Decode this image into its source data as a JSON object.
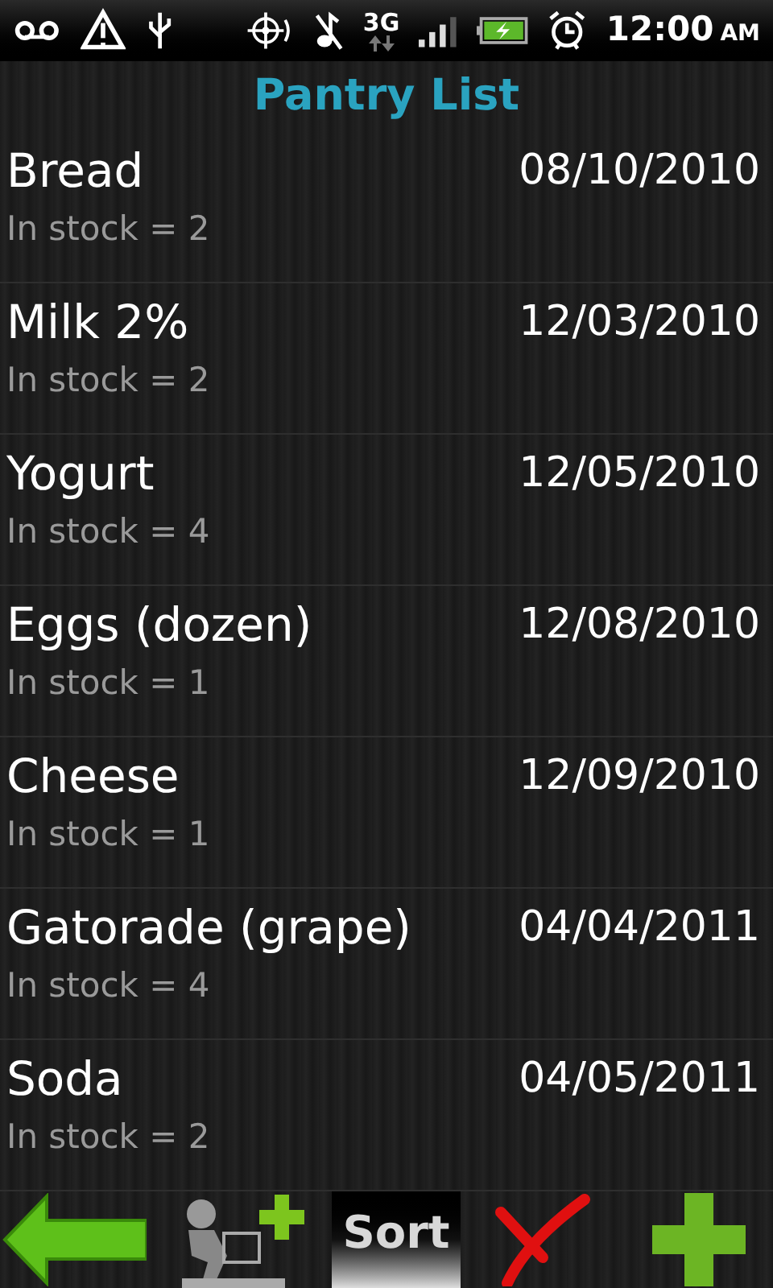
{
  "status_bar": {
    "network": "3G",
    "time": "12:00",
    "meridiem": "AM",
    "battery": {
      "charging": true
    }
  },
  "title": "Pantry List",
  "items": [
    {
      "name": "Bread",
      "date": "08/10/2010",
      "stock": "In stock =  2"
    },
    {
      "name": "Milk 2%",
      "date": "12/03/2010",
      "stock": "In stock =  2"
    },
    {
      "name": "Yogurt",
      "date": "12/05/2010",
      "stock": "In stock =  4"
    },
    {
      "name": "Eggs (dozen)",
      "date": "12/08/2010",
      "stock": "In stock =  1"
    },
    {
      "name": "Cheese",
      "date": "12/09/2010",
      "stock": "In stock =  1"
    },
    {
      "name": "Gatorade (grape)",
      "date": "04/04/2011",
      "stock": "In stock =  4"
    },
    {
      "name": "Soda",
      "date": "04/05/2011",
      "stock": "In stock =  2"
    }
  ],
  "toolbar": [
    {
      "kind": "back"
    },
    {
      "kind": "shop"
    },
    {
      "kind": "sort",
      "label": "Sort"
    },
    {
      "kind": "delete"
    },
    {
      "kind": "add"
    }
  ]
}
